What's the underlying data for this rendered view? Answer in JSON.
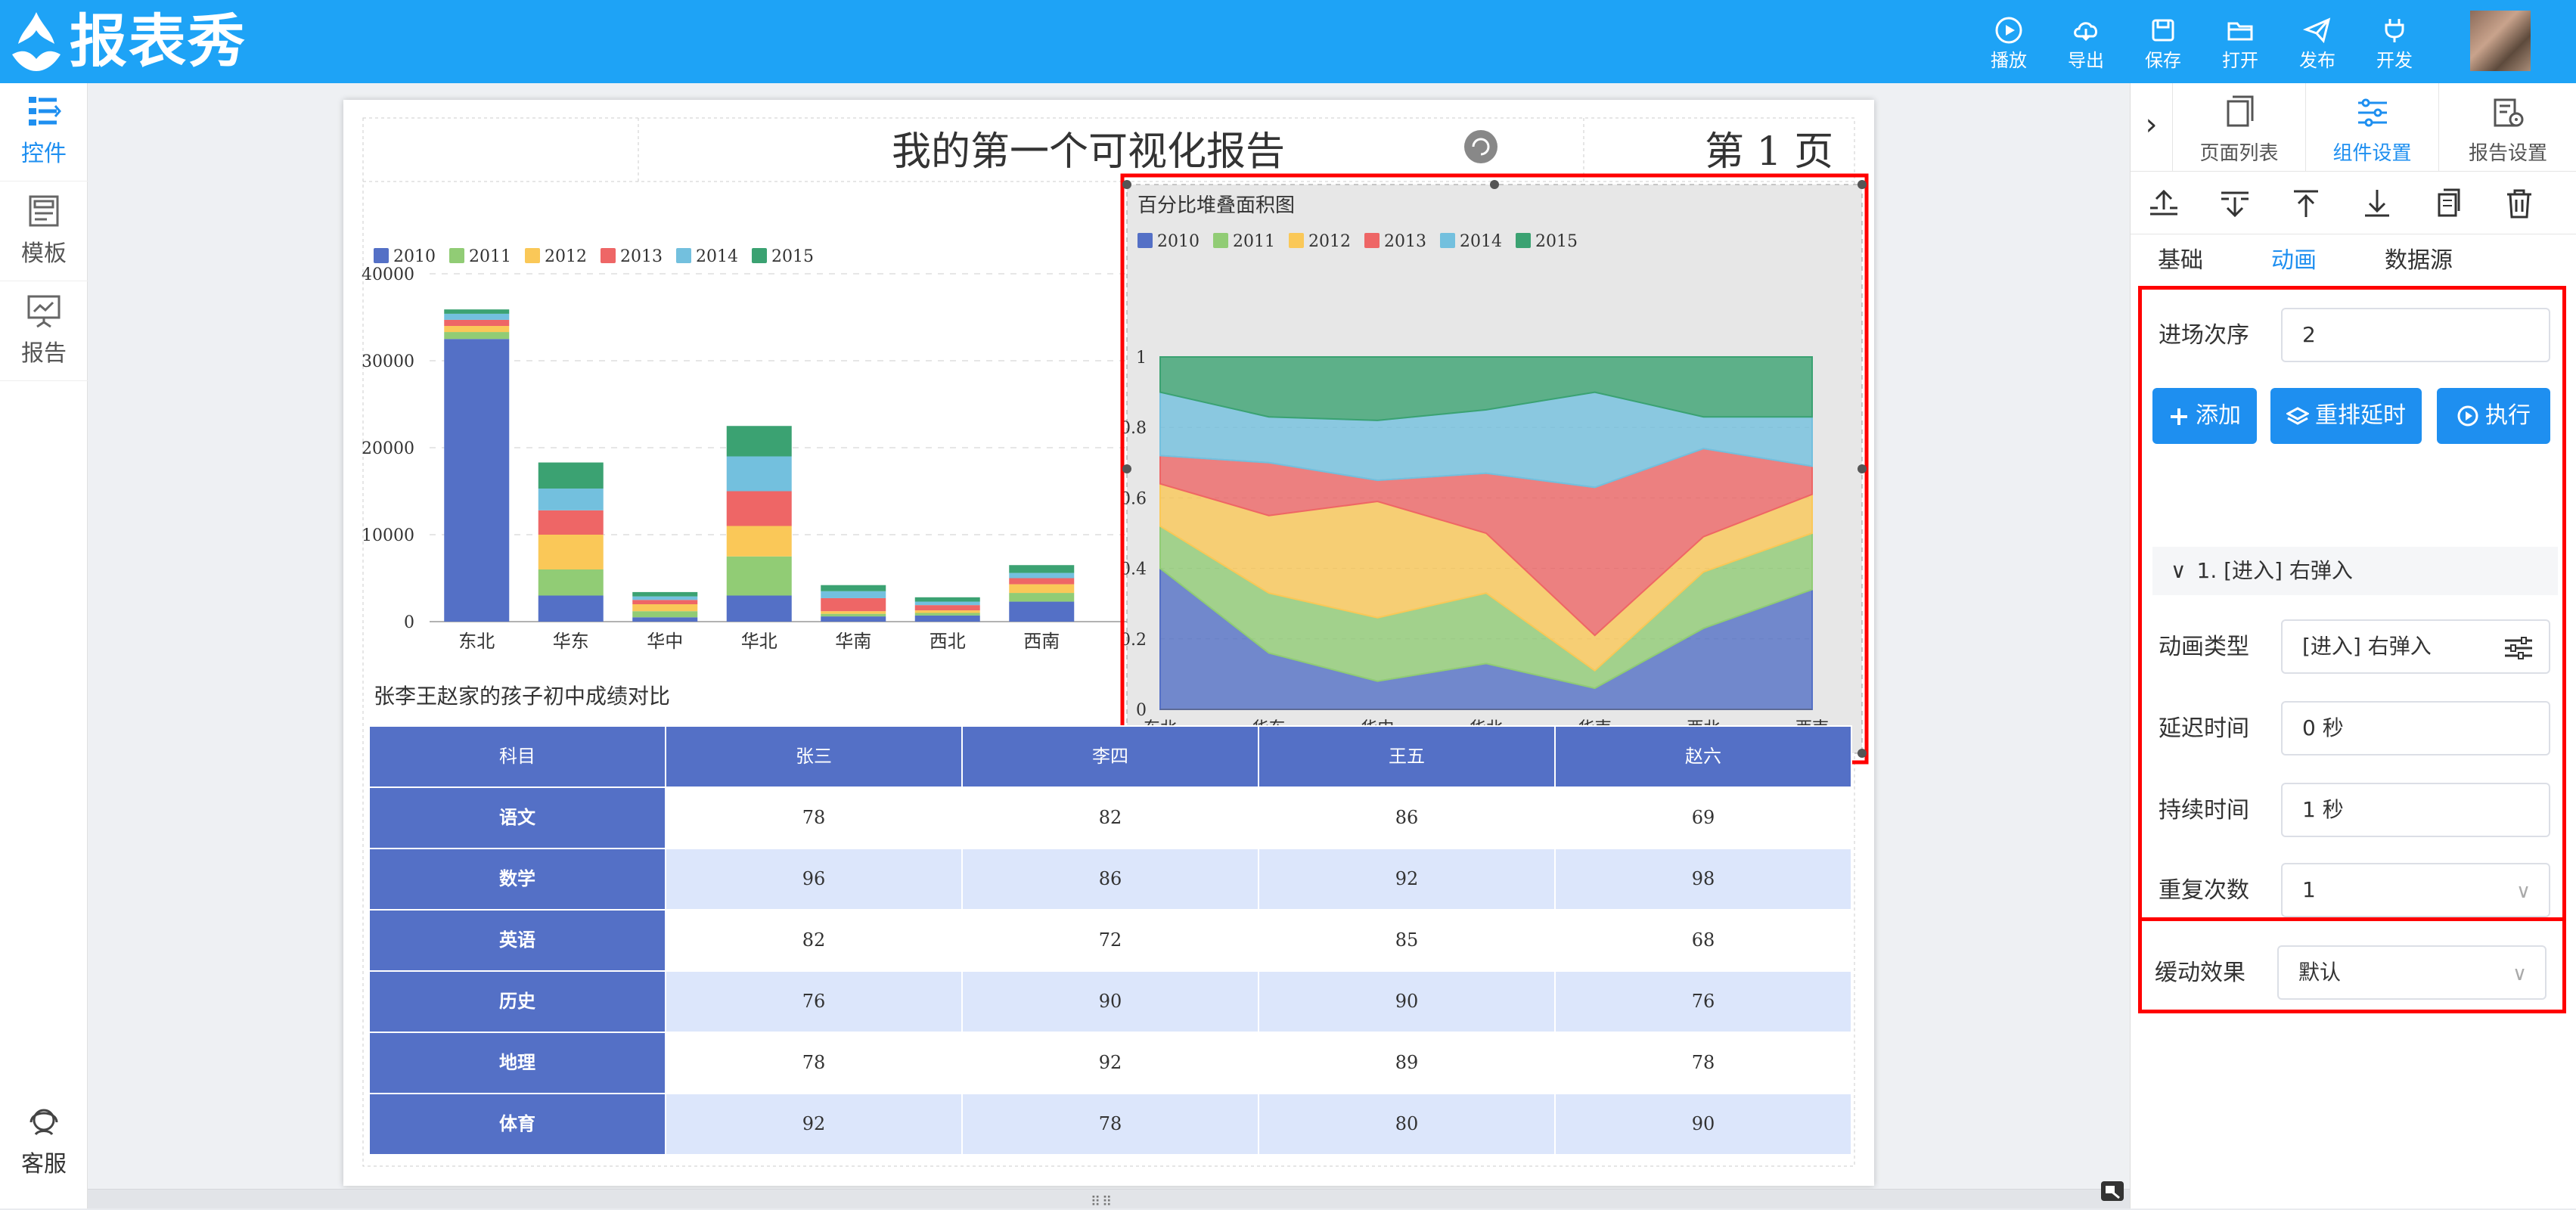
{
  "app": {
    "logo_text": "报表秀"
  },
  "toolbar": {
    "play": "播放",
    "export": "导出",
    "save": "保存",
    "open": "打开",
    "publish": "发布",
    "develop": "开发"
  },
  "leftnav": {
    "controls": "控件",
    "templates": "模板",
    "reports": "报告",
    "service": "客服"
  },
  "report": {
    "title": "我的第一个可视化报告",
    "page_label": "第 1 页",
    "table_title": "张李王赵家的孩子初中成绩对比"
  },
  "bar_chart": {
    "chart_data": {
      "type": "bar",
      "stacked": true,
      "categories": [
        "东北",
        "华东",
        "华中",
        "华北",
        "华南",
        "西北",
        "西南"
      ],
      "series": [
        {
          "name": "2010",
          "color": "#5470c6",
          "values": [
            32500,
            3000,
            500,
            3000,
            600,
            700,
            2300
          ]
        },
        {
          "name": "2011",
          "color": "#91cc75",
          "values": [
            800,
            3000,
            700,
            4500,
            300,
            300,
            1000
          ]
        },
        {
          "name": "2012",
          "color": "#fac858",
          "values": [
            700,
            4000,
            800,
            3500,
            300,
            300,
            1000
          ]
        },
        {
          "name": "2013",
          "color": "#ee6666",
          "values": [
            700,
            2800,
            500,
            4000,
            1500,
            600,
            700
          ]
        },
        {
          "name": "2014",
          "color": "#73c0de",
          "values": [
            700,
            2500,
            400,
            4000,
            800,
            400,
            600
          ]
        },
        {
          "name": "2015",
          "color": "#3ba272",
          "values": [
            500,
            3000,
            500,
            3500,
            700,
            500,
            900
          ]
        }
      ],
      "yticks": [
        "0",
        "10000",
        "20000",
        "30000",
        "40000"
      ],
      "ylim": [
        0,
        40000
      ],
      "legend_position": "top-left",
      "grid": "horizontal dashed"
    }
  },
  "area_chart": {
    "chart_data": {
      "type": "area",
      "stacked": true,
      "percent": true,
      "title": "百分比堆叠面积图",
      "categories": [
        "东北",
        "华东",
        "华中",
        "华北",
        "华南",
        "西北",
        "西南"
      ],
      "series": [
        {
          "name": "2010",
          "color": "#5470c6",
          "values": [
            0.4,
            0.16,
            0.08,
            0.13,
            0.06,
            0.23,
            0.34
          ]
        },
        {
          "name": "2011",
          "color": "#91cc75",
          "values": [
            0.12,
            0.17,
            0.18,
            0.2,
            0.05,
            0.16,
            0.16
          ]
        },
        {
          "name": "2012",
          "color": "#fac858",
          "values": [
            0.12,
            0.22,
            0.33,
            0.17,
            0.1,
            0.1,
            0.11
          ]
        },
        {
          "name": "2013",
          "color": "#ee6666",
          "values": [
            0.08,
            0.15,
            0.06,
            0.17,
            0.42,
            0.25,
            0.08
          ]
        },
        {
          "name": "2014",
          "color": "#73c0de",
          "values": [
            0.18,
            0.13,
            0.17,
            0.18,
            0.27,
            0.09,
            0.14
          ]
        },
        {
          "name": "2015",
          "color": "#3ba272",
          "values": [
            0.1,
            0.17,
            0.18,
            0.15,
            0.1,
            0.17,
            0.17
          ]
        }
      ],
      "yticks": [
        "0",
        "0.2",
        "0.4",
        "0.6",
        "0.8",
        "1"
      ],
      "ylim": [
        0,
        1
      ],
      "legend_position": "top-left"
    }
  },
  "score_table": {
    "headers": [
      "科目",
      "张三",
      "李四",
      "王五",
      "赵六"
    ],
    "rows": [
      [
        "语文",
        "78",
        "82",
        "86",
        "69"
      ],
      [
        "数学",
        "96",
        "86",
        "92",
        "98"
      ],
      [
        "英语",
        "82",
        "72",
        "85",
        "68"
      ],
      [
        "历史",
        "76",
        "90",
        "90",
        "76"
      ],
      [
        "地理",
        "78",
        "92",
        "89",
        "78"
      ],
      [
        "体育",
        "92",
        "78",
        "80",
        "90"
      ]
    ]
  },
  "rightpanel": {
    "tabs": {
      "pages": "页面列表",
      "component": "组件设置",
      "report": "报告设置"
    },
    "subtabs": {
      "basic": "基础",
      "animation": "动画",
      "datasource": "数据源"
    },
    "entry_order_label": "进场次序",
    "entry_order_value": "2",
    "add_label": "添加",
    "rearrange_label": "重排延时",
    "execute_label": "执行",
    "anim_item": "1. [进入] 右弹入",
    "type_label": "动画类型",
    "type_value": "[进入] 右弹入",
    "delay_label": "延迟时间",
    "delay_value": "0 秒",
    "duration_label": "持续时间",
    "duration_value": "1 秒",
    "repeat_label": "重复次数",
    "repeat_value": "1",
    "easing_label": "缓动效果",
    "easing_value": "默认"
  },
  "colors": {
    "primary": "#1ea3f6",
    "accent": "#1e8ff0",
    "selection": "#ff0000",
    "table_header": "#5470c6"
  }
}
